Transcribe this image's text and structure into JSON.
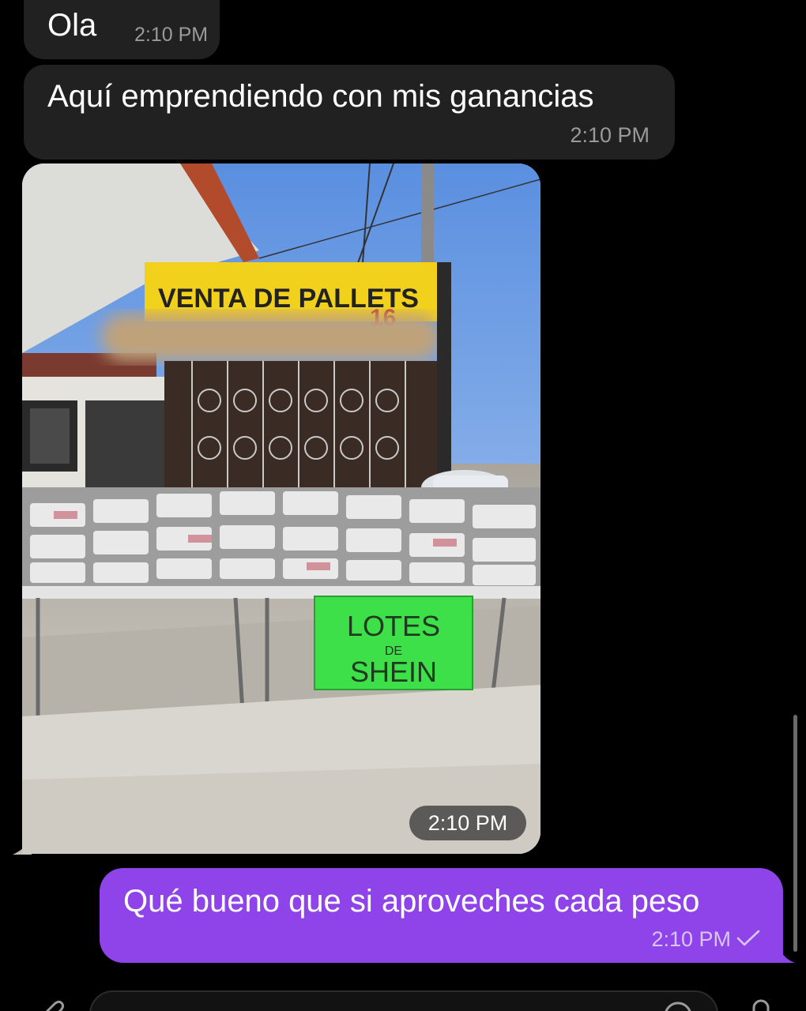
{
  "messages": [
    {
      "direction": "incoming",
      "text": "Ola",
      "time": "2:10 PM"
    },
    {
      "direction": "incoming",
      "text": "Aquí emprendiendo con mis ganancias",
      "time": "2:10 PM"
    },
    {
      "direction": "incoming",
      "type": "photo",
      "time": "2:10 PM",
      "photo_sign_main": "VENTA DE PALLETS",
      "photo_sign_number": "16",
      "photo_green_sign_line1": "LOTES",
      "photo_green_sign_line2": "DE",
      "photo_green_sign_line3": "SHEIN"
    },
    {
      "direction": "outgoing",
      "text": "Qué bueno que si aproveches cada peso",
      "time": "2:10 PM",
      "status": "sent"
    }
  ],
  "composer": {
    "icons": [
      "attach-icon",
      "sticker-icon",
      "microphone-icon"
    ]
  },
  "colors": {
    "background": "#000000",
    "incoming_bubble": "#212121",
    "outgoing_bubble": "#8e44e8",
    "time_incoming": "#9a9a9a",
    "time_outgoing": "#d9c5f7"
  }
}
